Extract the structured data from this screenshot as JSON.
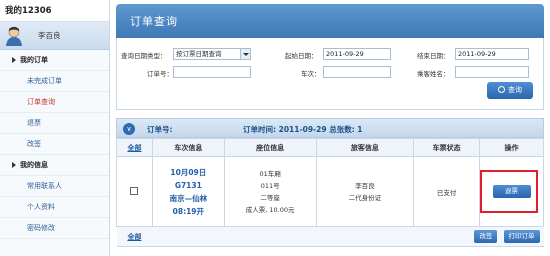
{
  "sidebar": {
    "title": "我的12306",
    "user_name": "李百良",
    "items": [
      {
        "label": "我的订单",
        "type": "group"
      },
      {
        "label": "未完成订单",
        "type": "item"
      },
      {
        "label": "订单查询",
        "type": "active"
      },
      {
        "label": "退票",
        "type": "item"
      },
      {
        "label": "改签",
        "type": "item"
      },
      {
        "label": "我的信息",
        "type": "group"
      },
      {
        "label": "常用联系人",
        "type": "item"
      },
      {
        "label": "个人资料",
        "type": "item"
      },
      {
        "label": "密码修改",
        "type": "item"
      }
    ]
  },
  "page_title": "订单查询",
  "form": {
    "date_type_label": "查询日期类型：",
    "date_type_value": "按订票日期查询",
    "start_label": "起始日期：",
    "start_value": "2011-09-29",
    "end_label": "结束日期：",
    "end_value": "2011-09-29",
    "order_no_label": "订单号：",
    "train_no_label": "车次：",
    "passenger_label": "乘客姓名：",
    "query_button": "查询"
  },
  "result_bar": {
    "order_label": "订单号:",
    "order_time": "订单时间:  2011-09-29 总张数: 1"
  },
  "table": {
    "headers": [
      "全部",
      "车次信息",
      "座位信息",
      "旅客信息",
      "车票状态",
      "操作"
    ],
    "row": {
      "train_date": "10月09日",
      "train_no": "G7131",
      "route": "南京—仙林",
      "time": "08:19开",
      "car": "01车厢",
      "seat": "011号",
      "seat_class": "二等座",
      "price": "成人票, 10.00元",
      "passenger_name": "李百良",
      "id_type": "二代身份证",
      "status": "已支付",
      "refund_button": "退票"
    },
    "footer_all": "全部",
    "change_button": "改签",
    "print_button": "打印订单"
  },
  "colors": {
    "accent": "#3f79b7",
    "highlight_box": "#e0202a",
    "active_menu": "#c8352a"
  }
}
